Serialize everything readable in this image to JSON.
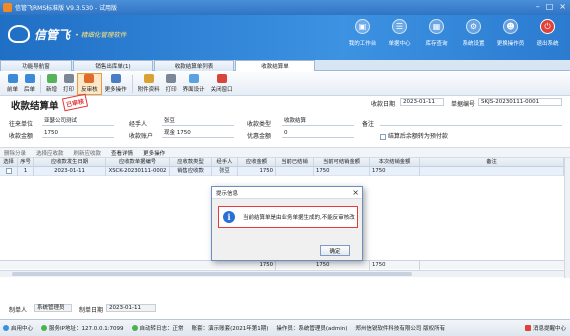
{
  "app": {
    "title": "信管飞RMS标准版 V9.3.530 - 试用版"
  },
  "brand": {
    "name": "信管飞",
    "slogan": "• 精细化管理软件"
  },
  "topnav": [
    {
      "label": "我的工作台",
      "icon": "desktop-icon"
    },
    {
      "label": "单据中心",
      "icon": "documents-icon"
    },
    {
      "label": "库存查询",
      "icon": "inventory-icon"
    },
    {
      "label": "系统设置",
      "icon": "settings-icon"
    },
    {
      "label": "更换操作员",
      "icon": "user-switch-icon"
    },
    {
      "label": "退出系统",
      "icon": "power-icon"
    }
  ],
  "tabs": [
    "功能导航窗",
    "销售出库单(1)",
    "收款结算单列表",
    "收款结算单"
  ],
  "toolbar": [
    "前单",
    "后单",
    "新增",
    "打印",
    "反审核",
    "更多操作",
    "附件资料",
    "打印",
    "界面设计",
    "关闭窗口"
  ],
  "form": {
    "title": "收款结算单",
    "stamp": "已审核",
    "doc_date_label": "收款日期",
    "doc_date": "2023-01-11",
    "doc_no_label": "单据编号",
    "doc_no": "SKJS-20230111-0001",
    "client_label": "往来单位",
    "client": "亚瑟公司测试",
    "handler_label": "经手人",
    "handler": "张豆",
    "type_label": "收款类型",
    "type": "收款结算",
    "remark_label": "备注",
    "amount_label": "收款金额",
    "amount": "1750",
    "account_label": "收款账户",
    "account": "现金 1750",
    "discount_label": "优惠金额",
    "discount": "0",
    "checkbox_label": "结算后余额转为预付款"
  },
  "gridbar": [
    "删除分录",
    "选择应收款",
    "刷新应收款",
    "查看详情",
    "更多操作"
  ],
  "grid": {
    "headers": [
      "选择",
      "序号",
      "应收款发生日期",
      "应收款单据编号",
      "应收款类型",
      "经手人",
      "应收金额",
      "当前已结销",
      "当前可结销金额",
      "本次结销金额",
      "备注"
    ],
    "rows": [
      [
        "",
        "1",
        "2023-01-11",
        "XSCK-20230111-0002",
        "销售应收款",
        "张豆",
        "1750",
        "",
        "1750",
        "1750",
        ""
      ]
    ],
    "footer": [
      "1750",
      "1750",
      "1750"
    ]
  },
  "bottom": {
    "maker_label": "制单人",
    "maker": "系统管理员",
    "make_date_label": "制单日期",
    "make_date": "2023-01-11"
  },
  "status": [
    "启用中心",
    "服务IP地址：127.0.0.1:7099",
    "自动转日志：正常",
    "账套：演示账套(2021年第1期)",
    "操作员：系统管理员(admin)",
    "郑州信锐软件科技有限公司 版权所有",
    "消息提醒中心"
  ],
  "dialog": {
    "title": "提示信息",
    "message": "当前结算单是由业务单据生成的,不能反审核改",
    "ok": "确定"
  }
}
